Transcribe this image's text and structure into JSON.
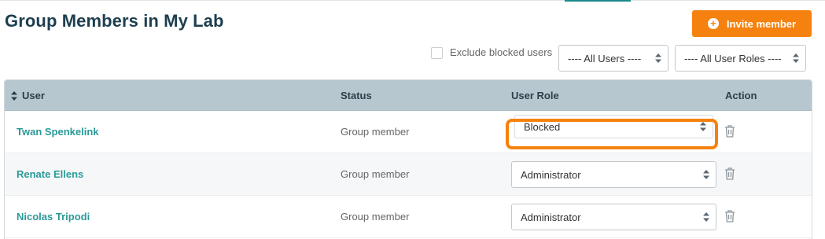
{
  "page": {
    "title": "Group Members in My Lab"
  },
  "toolbar": {
    "invite_label": "Invite member",
    "exclude_label": "Exclude blocked users",
    "exclude_checked": false,
    "user_filter": "---- All Users ----",
    "role_filter": "---- All User Roles ----"
  },
  "table": {
    "headers": {
      "user": "User",
      "status": "Status",
      "role": "User Role",
      "action": "Action"
    },
    "rows": [
      {
        "name": "Twan Spenkelink",
        "status": "Group member",
        "role": "Blocked"
      },
      {
        "name": "Renate Ellens",
        "status": "Group member",
        "role": "Administrator"
      },
      {
        "name": "Nicolas Tripodi",
        "status": "Group member",
        "role": "Administrator"
      }
    ]
  },
  "colors": {
    "accent": "#f5820f",
    "link": "#2a9a98",
    "title": "#1d3e4f",
    "header_bg": "#b7c7cf"
  },
  "icons": {
    "invite": "plus-circle-icon",
    "sort": "sort-icon",
    "select_arrows": "select-arrows-icon",
    "delete": "trash-icon"
  }
}
